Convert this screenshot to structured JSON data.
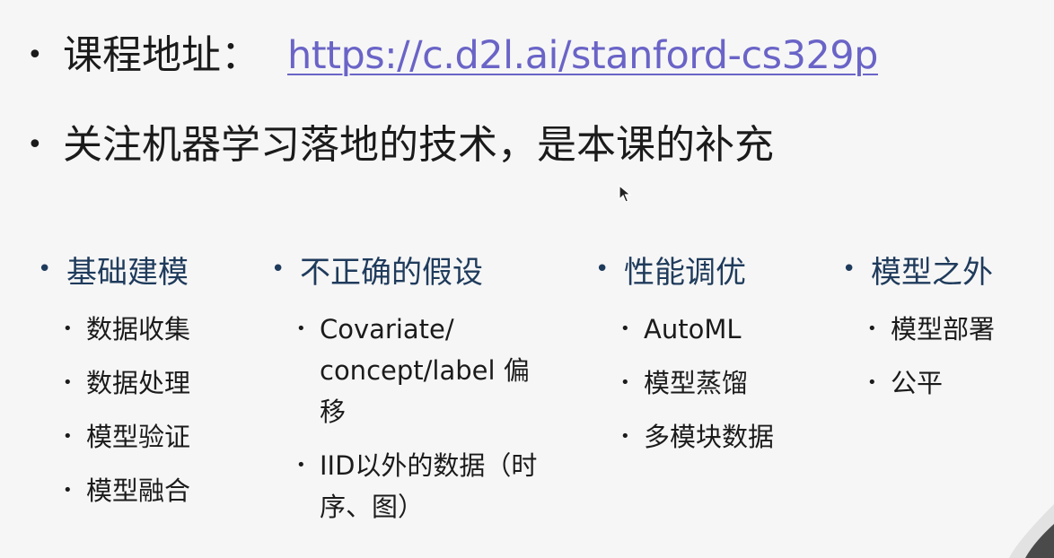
{
  "bullets": {
    "course_label": "课程地址：",
    "course_url": "https://c.d2l.ai/stanford-cs329p",
    "focus": "关注机器学习落地的技术，是本课的补充"
  },
  "columns": [
    {
      "title": "基础建模",
      "items": [
        "数据收集",
        "数据处理",
        "模型验证",
        "模型融合"
      ]
    },
    {
      "title": "不正确的假设",
      "items": [
        "Covariate/ concept/label 偏移",
        "IID以外的数据（时序、图）"
      ]
    },
    {
      "title": "性能调优",
      "items": [
        "AutoML",
        "模型蒸馏",
        "多模块数据"
      ]
    },
    {
      "title": "模型之外",
      "items": [
        "模型部署",
        "公平"
      ]
    }
  ],
  "colors": {
    "background": "#f6f6f6",
    "text": "#1b1b1b",
    "heading": "#1f3b5c",
    "link": "#6a64c7"
  },
  "icons": {
    "cursor": "mouse-pointer-icon"
  }
}
